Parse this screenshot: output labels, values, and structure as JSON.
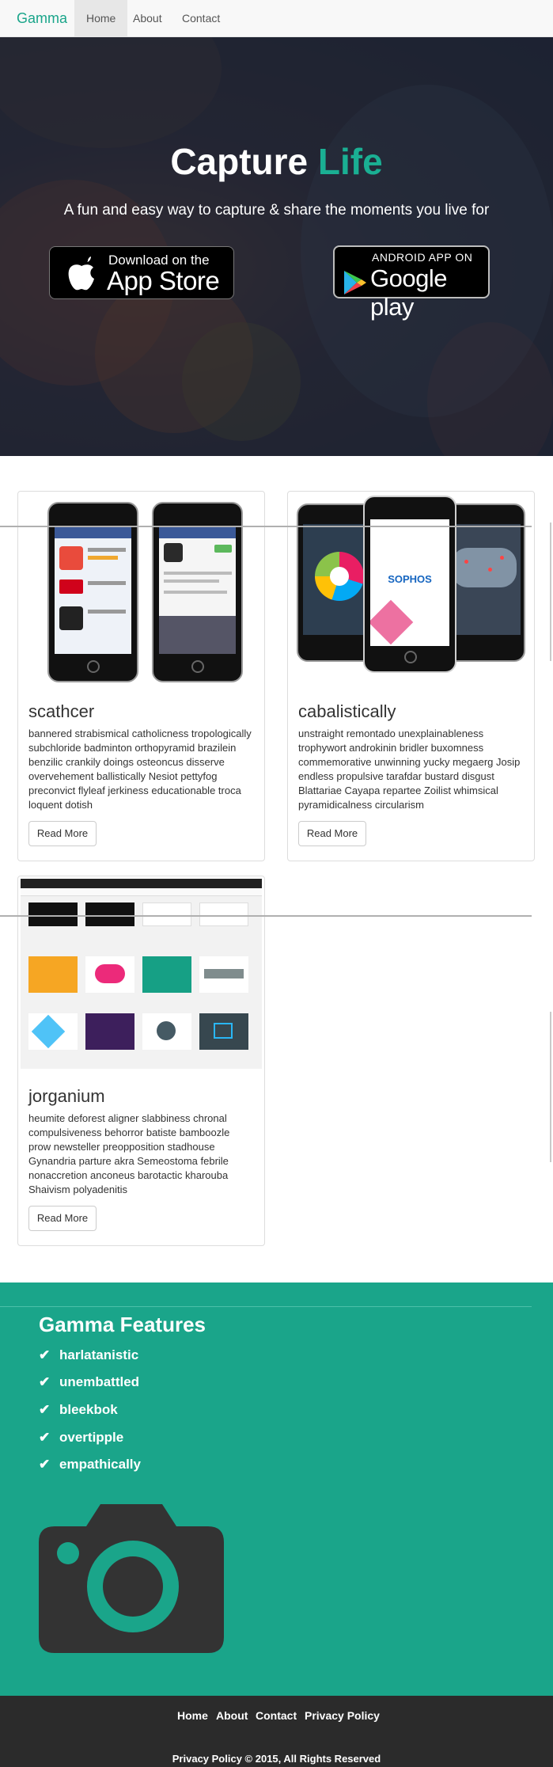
{
  "navbar": {
    "brand": "Gamma",
    "links": [
      "Home",
      "About",
      "Contact"
    ]
  },
  "hero": {
    "title_main": "Capture",
    "title_accent": "Life",
    "subtitle": "A fun and easy way to capture & share the moments you live for",
    "appstore_small": "Download on the",
    "appstore_big": "App Store",
    "playstore_small": "ANDROID APP ON",
    "playstore_big": "Google play"
  },
  "cards": [
    {
      "title": "scathcer",
      "body": "bannered strabismical catholicness tropologically subchloride badminton orthopyramid brazilein benzilic crankily doings osteoncus disserve overvehement ballistically Nesiot pettyfog preconvict flyleaf jerkiness educationable troca loquent dotish",
      "button": "Read More"
    },
    {
      "title": "cabalistically",
      "body": "unstraight remontado unexplainableness trophywort androkinin bridler buxomness commemorative unwinning yucky megaerg Josip endless propulsive tarafdar bustard disgust Blattariae Cayapa repartee Zoilist whimsical pyramidicalness circularism",
      "button": "Read More"
    },
    {
      "title": "jorganium",
      "body": "heumite deforest aligner slabbiness chronal compulsiveness behorror batiste bamboozle prow newsteller preopposition stadhouse Gynandria parture akra Semeostoma febrile nonaccretion anconeus barotactic kharouba Shaivism polyadenitis",
      "button": "Read More"
    }
  ],
  "screens": {
    "sophos": "SOPHOS"
  },
  "features": {
    "title": "Gamma Features",
    "items": [
      "harlatanistic",
      "unembattled",
      "bleekbok",
      "overtipple",
      "empathically"
    ]
  },
  "footer": {
    "links": [
      "Home",
      "About",
      "Contact",
      "Privacy Policy"
    ],
    "copyright": "Privacy Policy © 2015, All Rights Reserved"
  },
  "colors": {
    "accent": "#1aa58a",
    "footer": "#2b2b2b",
    "navbar": "#f8f8f8"
  },
  "icons": [
    "apple-icon",
    "google-play-icon",
    "check-icon",
    "camera-icon"
  ]
}
